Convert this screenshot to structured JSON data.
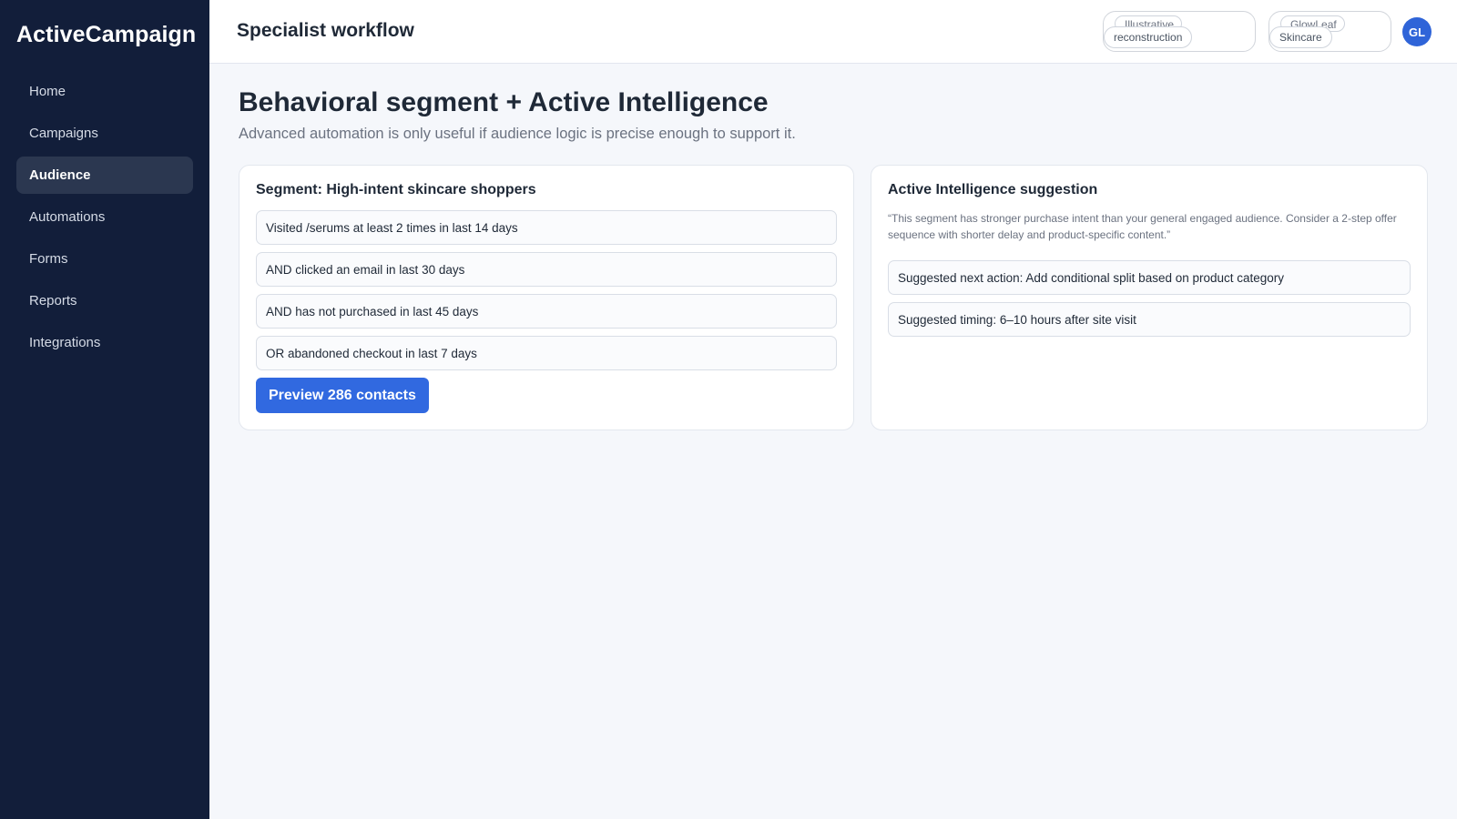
{
  "app": {
    "brand": "ActiveCampaign"
  },
  "sidebar": {
    "items": [
      {
        "label": "Home",
        "active": false
      },
      {
        "label": "Campaigns",
        "active": false
      },
      {
        "label": "Audience",
        "active": true
      },
      {
        "label": "Automations",
        "active": false
      },
      {
        "label": "Forms",
        "active": false
      },
      {
        "label": "Reports",
        "active": false
      },
      {
        "label": "Integrations",
        "active": false
      }
    ]
  },
  "header": {
    "title": "Specialist workflow",
    "chip1": {
      "line1": "Illustrative",
      "line2": "reconstruction"
    },
    "chip2": {
      "line1": "GlowLeaf",
      "line2": "Skincare"
    },
    "avatar_initials": "GL"
  },
  "main": {
    "title": "Behavioral segment + Active Intelligence",
    "subtitle": "Advanced automation is only useful if audience logic is precise enough to support it."
  },
  "segment": {
    "title": "Segment: High-intent skincare shoppers",
    "rules": [
      "Visited /serums at least 2 times in last 14 days",
      "AND clicked an email in last 30 days",
      "AND has not purchased in last 45 days",
      "OR abandoned checkout in last 7 days"
    ],
    "preview_label": "Preview 286 contacts"
  },
  "ai": {
    "title": "Active Intelligence suggestion",
    "quote": "“This segment has stronger purchase intent than your general engaged audience. Consider a 2-step offer sequence with shorter delay and product-specific content.”",
    "items": [
      "Suggested next action: Add conditional split based on product category",
      "Suggested timing: 6–10 hours after site visit"
    ]
  },
  "colors": {
    "sidebar_bg": "#121e3a",
    "accent": "#3169e0",
    "page_bg": "#f5f7fb"
  }
}
